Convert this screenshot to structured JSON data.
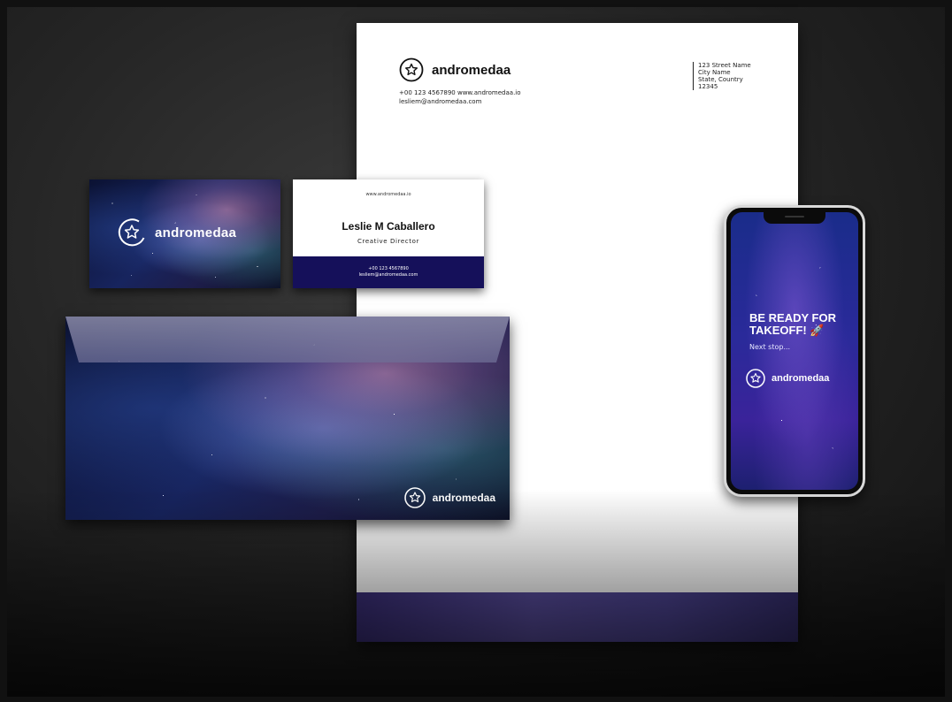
{
  "brand": {
    "name": "andromedaa"
  },
  "letterhead": {
    "phone_and_web": "+00 123 4567890  www.andromedaa.io",
    "email": "lesliem@andromedaa.com",
    "address_line1": "123 Street Name",
    "address_line2": "City Name",
    "address_line3": "State, Country",
    "address_line4": "12345"
  },
  "business_card_back": {
    "website": "www.andromedaa.io",
    "name": "Leslie M Caballero",
    "title": "Creative Director",
    "phone": "+00 123 4567890",
    "email": "lesliem@andromedaa.com"
  },
  "phone_screen": {
    "headline": "BE READY FOR TAKEOFF! 🚀",
    "subline": "Next stop..."
  },
  "colors": {
    "navy_band": "#15105a",
    "letterhead_footer": "#4e4595",
    "background": "#262626"
  },
  "icons": {
    "logo": "star-in-ring-icon"
  }
}
